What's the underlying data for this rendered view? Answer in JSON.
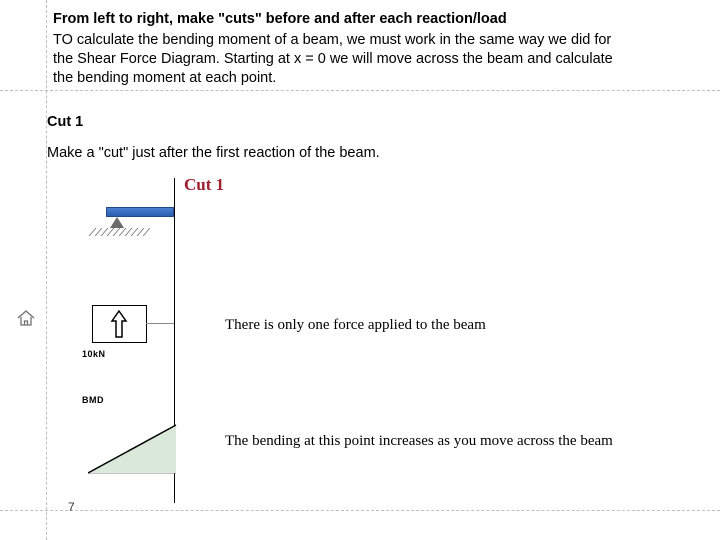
{
  "title": {
    "heading": "From left to right, make \"cuts\" before and after each reaction/load",
    "body": "TO calculate the bending moment of a beam, we must work in the same way we did for the Shear Force Diagram. Starting at x = 0 we will move across the beam and calculate the bending moment at each point."
  },
  "cut": {
    "label": "Cut 1",
    "desc": "Make a \"cut\" just after the first reaction of the beam.",
    "title": "Cut 1"
  },
  "diagram": {
    "force_label": "10kN",
    "bmd_label": "BMD"
  },
  "notes": {
    "n1": "There is only one force applied to the beam",
    "n2": "The bending at this point increases as you move across the beam"
  },
  "page_number": "7"
}
